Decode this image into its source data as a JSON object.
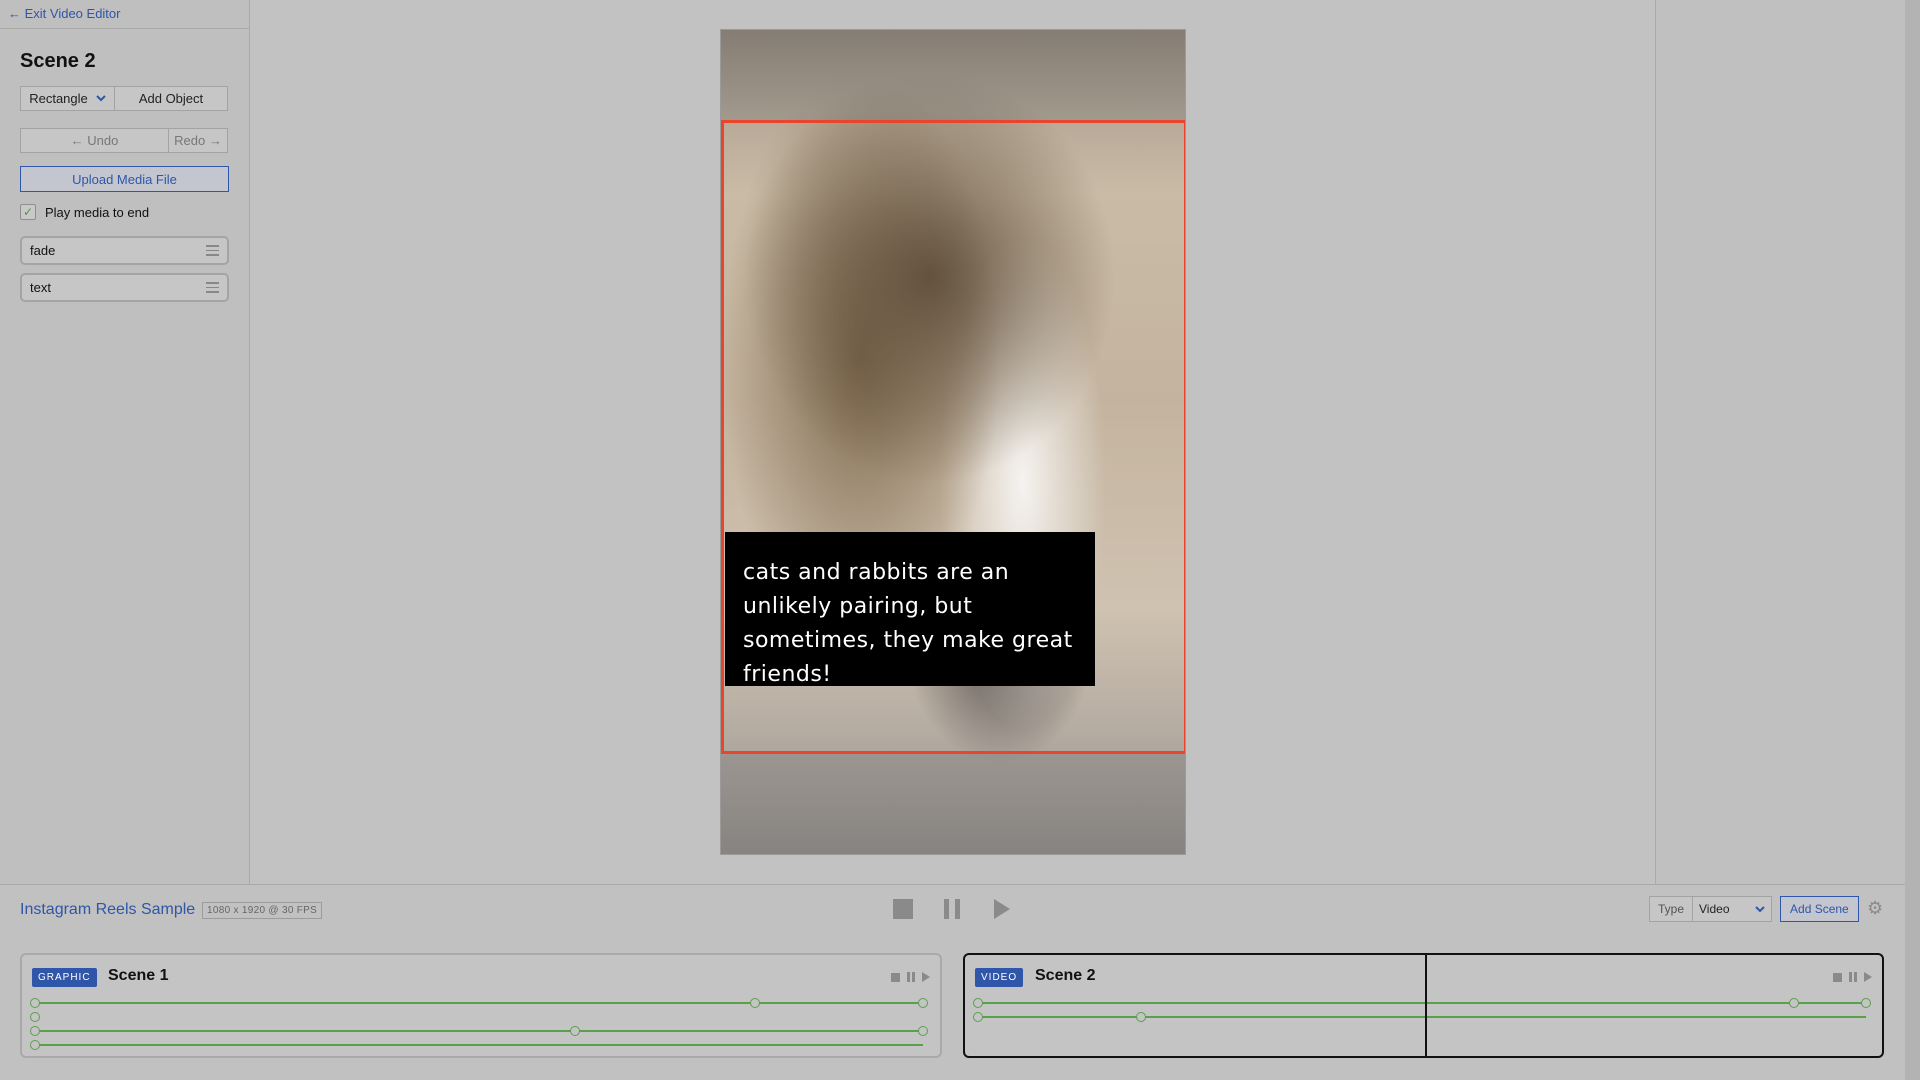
{
  "left_panel": {
    "exit_label": "← Exit Video Editor",
    "scene_title": "Scene 2",
    "shape_select_value": "Rectangle",
    "add_object_label": "Add Object",
    "undo_label": "← Undo",
    "redo_label": "Redo →",
    "upload_label": "Upload Media File",
    "play_to_end_label": "Play media to end",
    "play_to_end_checked": true,
    "objects": [
      {
        "label": "fade"
      },
      {
        "label": "text"
      }
    ]
  },
  "canvas": {
    "caption": "cats and rabbits are an unlikely pairing, but sometimes, they make great friends!",
    "selection_color": "#e8452c"
  },
  "project_bar": {
    "project_name": "Instagram Reels Sample",
    "project_meta": "1080 x 1920 @ 30 FPS",
    "type_label": "Type",
    "type_value": "Video",
    "add_scene_label": "Add Scene"
  },
  "timeline": {
    "scenes": [
      {
        "badge": "GRAPHIC",
        "name": "Scene 1"
      },
      {
        "badge": "VIDEO",
        "name": "Scene 2"
      }
    ]
  },
  "colors": {
    "accent": "#2f56a8",
    "track": "#5aa04a",
    "selection": "#e8452c"
  }
}
